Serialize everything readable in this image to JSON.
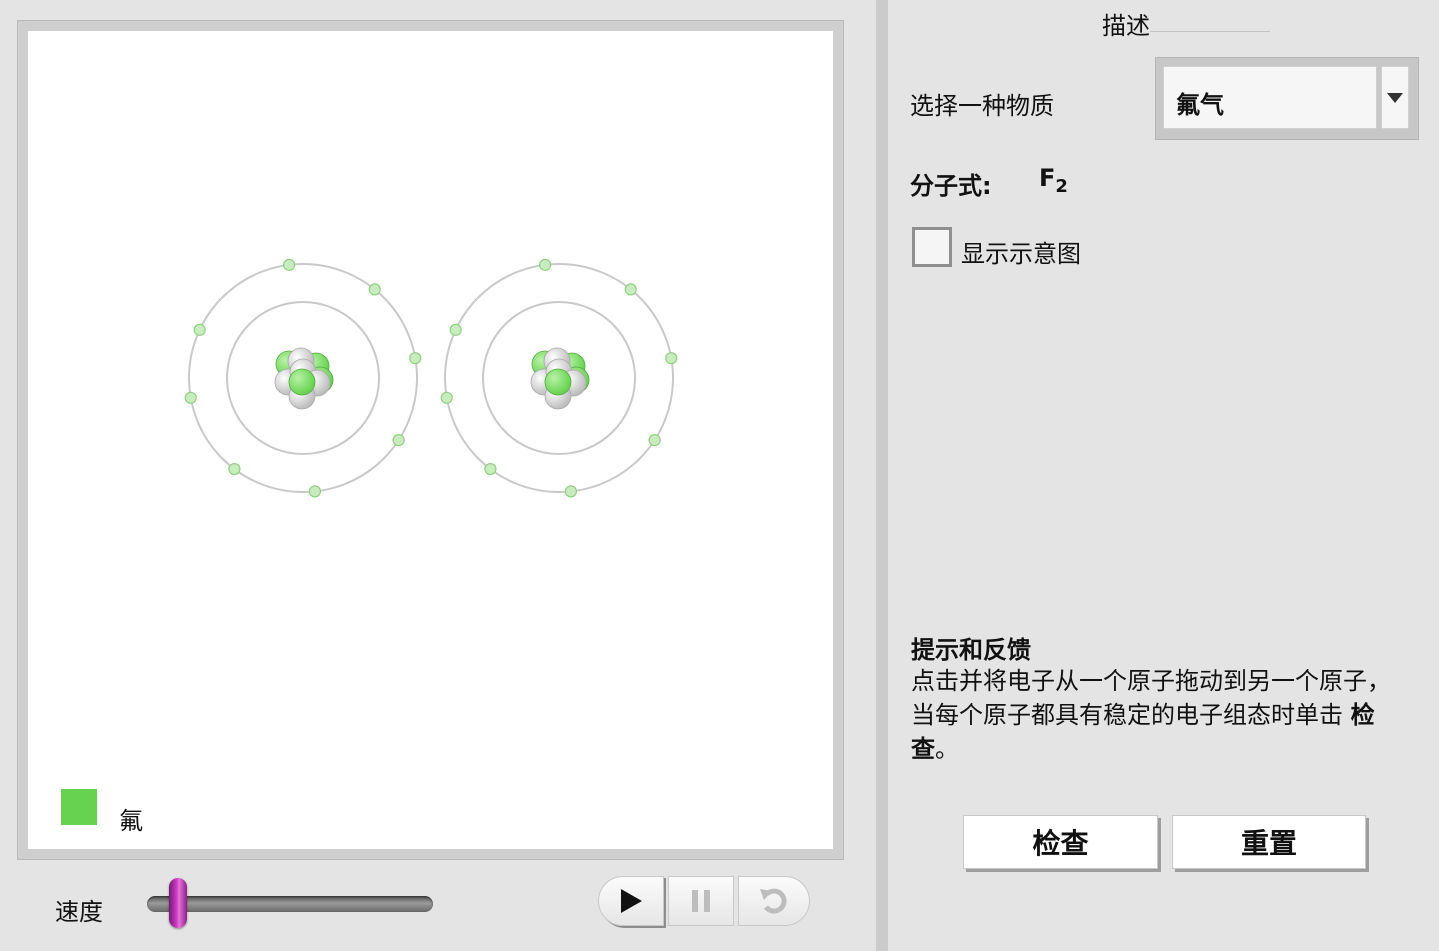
{
  "stage": {
    "atoms": [
      {
        "name": "fluorine-atom-1"
      },
      {
        "name": "fluorine-atom-2"
      }
    ],
    "legend": {
      "label": "氟",
      "color": "#66d24f"
    }
  },
  "controls": {
    "speed_label": "速度",
    "speed_value": 0.1,
    "buttons": {
      "play_icon": "play-icon",
      "pause_icon": "pause-icon",
      "rewind_icon": "rewind-icon"
    }
  },
  "panel": {
    "title": "描述",
    "substance_label": "选择一种物质",
    "substance_selected": "氟气",
    "formula_label": "分子式:",
    "formula_base": "F",
    "formula_sub": "2",
    "show_diagram_label": "显示示意图",
    "hint_title": "提示和反馈",
    "hint_text_prefix": "点击并将电子从一个原子拖动到另一个原子，当每个原子都具有稳定的电子组态时单击 ",
    "hint_text_bold": "检查",
    "hint_text_suffix": "。",
    "check_label": "检查",
    "reset_label": "重置"
  },
  "colors": {
    "nucleus_green": "#66d24f",
    "nucleus_gray": "#d6d6d6",
    "electron": "#c8ecbf",
    "orbit": "#c9c9c9"
  }
}
